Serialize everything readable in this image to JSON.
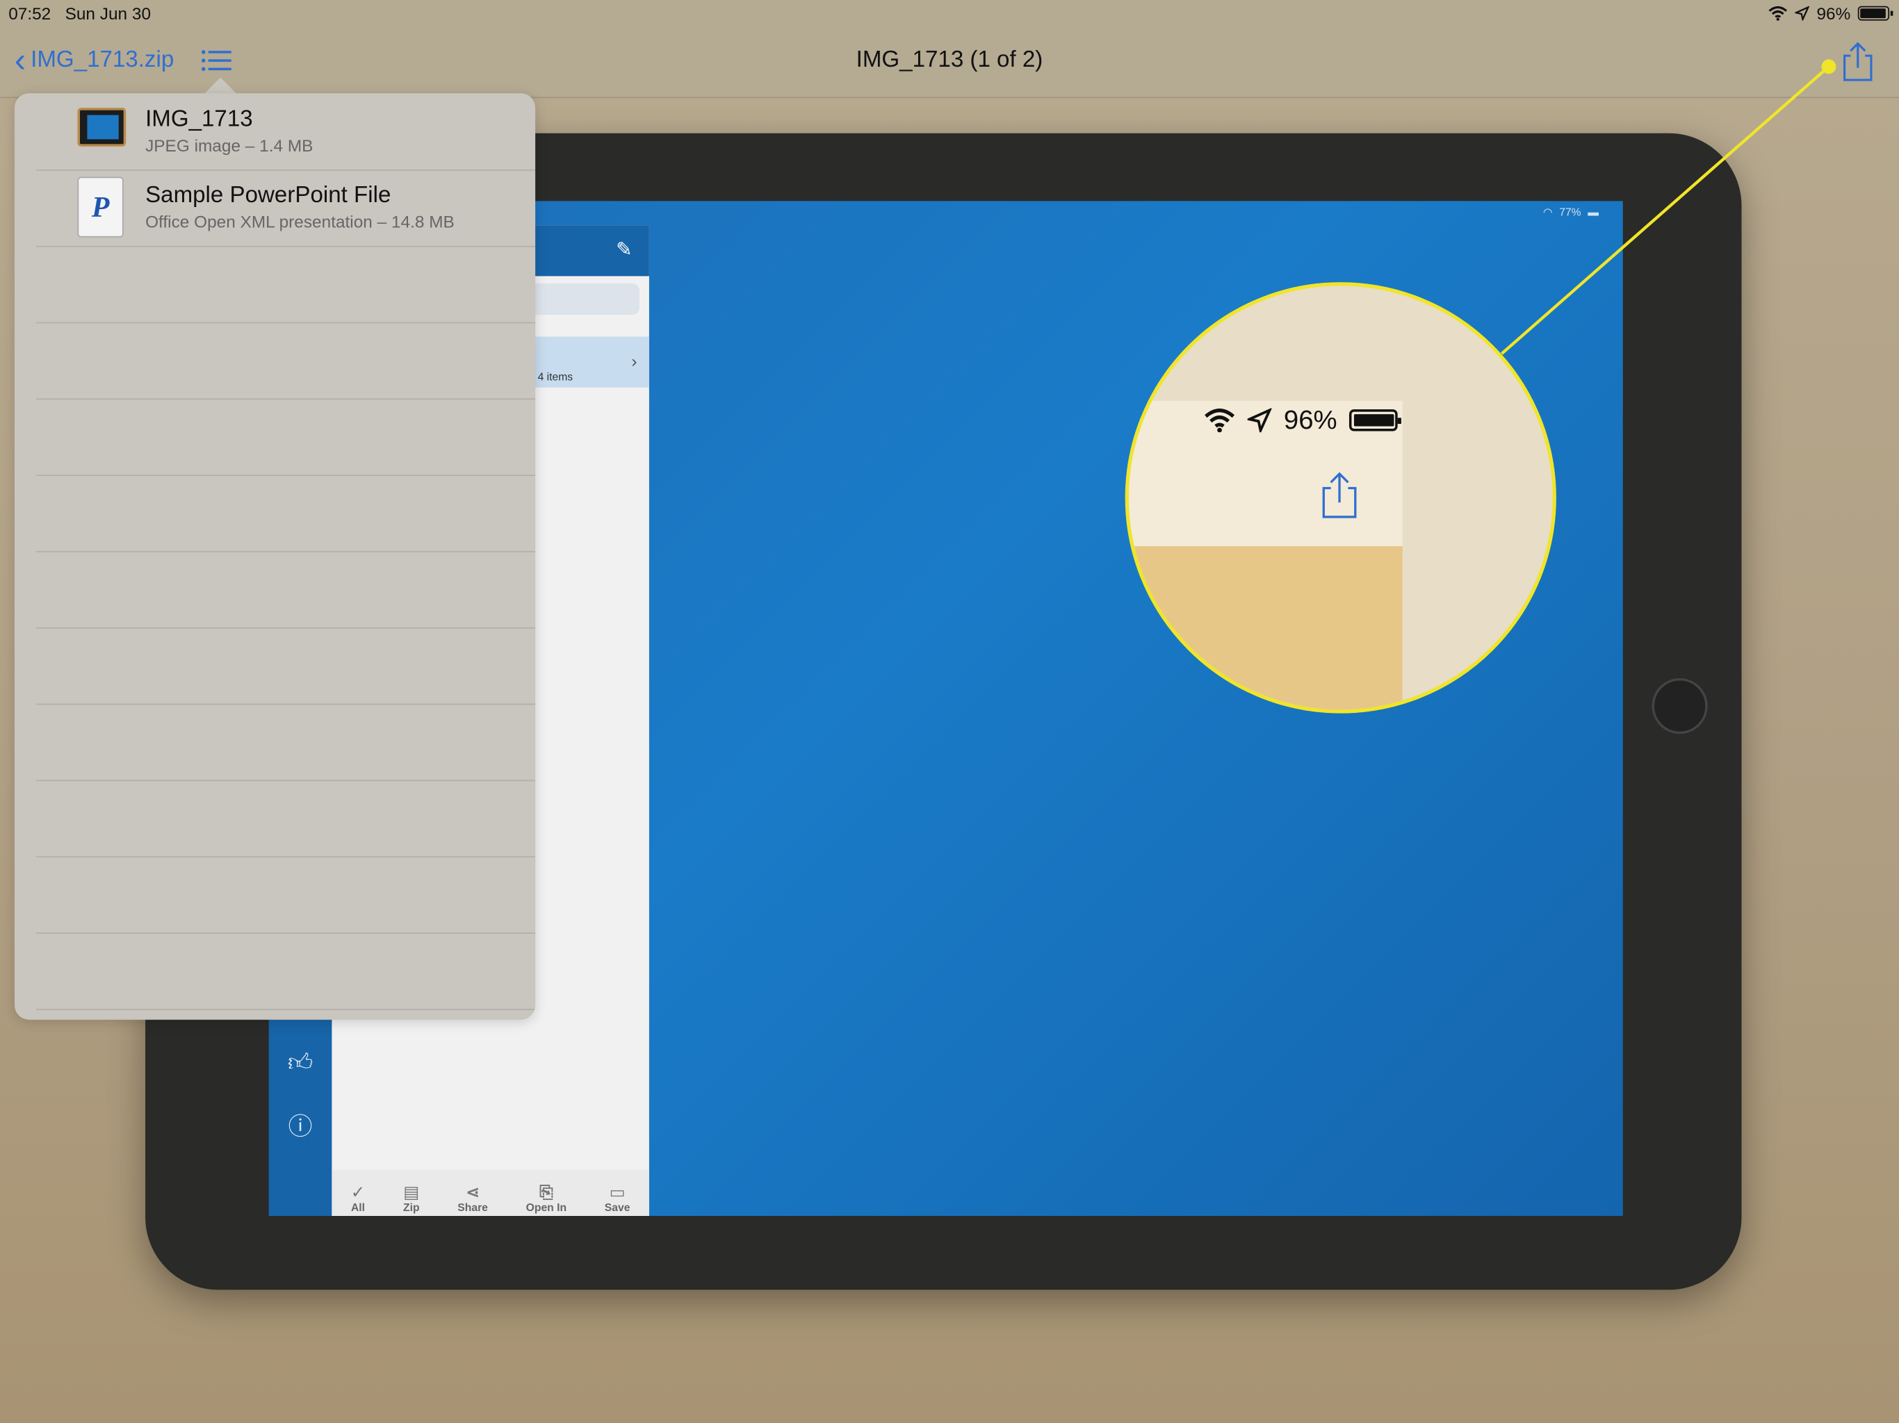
{
  "status_bar": {
    "time": "07:52",
    "date": "Sun Jun 30",
    "battery_percent": "96%",
    "battery_level": 0.96,
    "icons": [
      "wifi-icon",
      "location-icon",
      "battery-icon"
    ]
  },
  "nav": {
    "back_label": "IMG_1713.zip",
    "title": "IMG_1713 (1 of 2)",
    "icons": [
      "chevron-left-icon",
      "list-icon",
      "share-icon"
    ]
  },
  "popover": {
    "files": [
      {
        "name": "IMG_1713",
        "meta": "JPEG image – 1.4 MB",
        "icon": "image-thumbnail"
      },
      {
        "name": "Sample PowerPoint File",
        "meta": "Office Open XML presentation – 14.8 MB",
        "icon": "powerpoint-file-icon",
        "icon_letter": "P"
      }
    ]
  },
  "photo": {
    "ipad_status": "77%",
    "inner_row_label": "4 items",
    "inner_toolbar": [
      "All",
      "Zip",
      "Share",
      "Open In",
      "Save"
    ]
  },
  "callout": {
    "battery_percent": "96%",
    "color": "#f0e529"
  },
  "colors": {
    "accent": "#2f6fd1",
    "highlight": "#f0e529"
  }
}
